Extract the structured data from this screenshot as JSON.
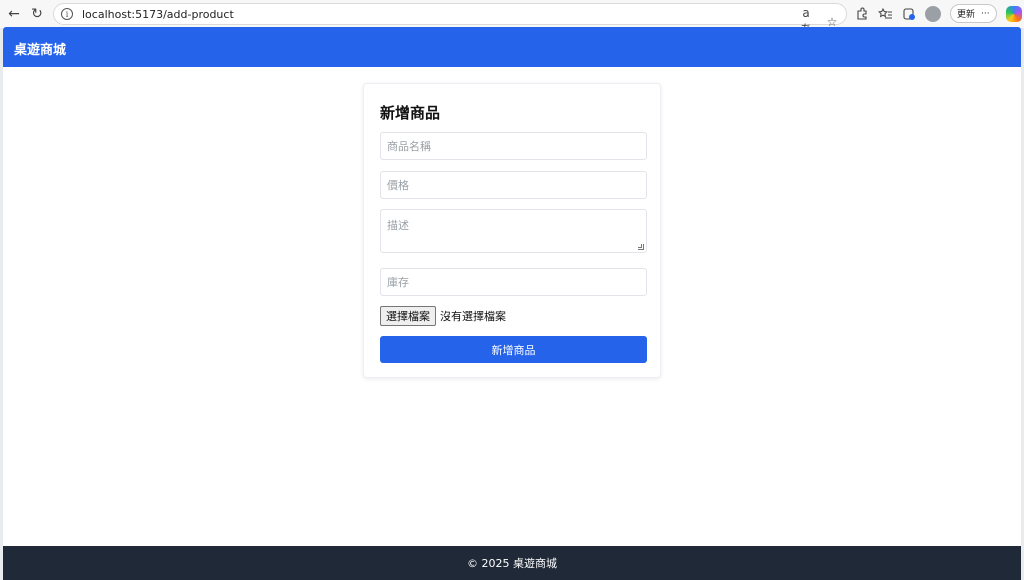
{
  "browser": {
    "back_icon": "←",
    "reload_icon": "↻",
    "url": "localhost:5173/add-product",
    "info_icon": "i",
    "read_aloud_icon": "aあ",
    "star_icon": "☆",
    "update_label": "更新",
    "more_label": "···"
  },
  "header": {
    "title": "桌遊商城"
  },
  "form": {
    "title": "新增商品",
    "name_placeholder": "商品名稱",
    "price_placeholder": "價格",
    "description_placeholder": "描述",
    "stock_placeholder": "庫存",
    "file_button_label": "選擇檔案",
    "file_status": "沒有選擇檔案",
    "submit_label": "新增商品"
  },
  "footer": {
    "text": "© 2025 桌遊商城"
  },
  "colors": {
    "primary": "#2563eb",
    "footer_bg": "#1f2937"
  }
}
